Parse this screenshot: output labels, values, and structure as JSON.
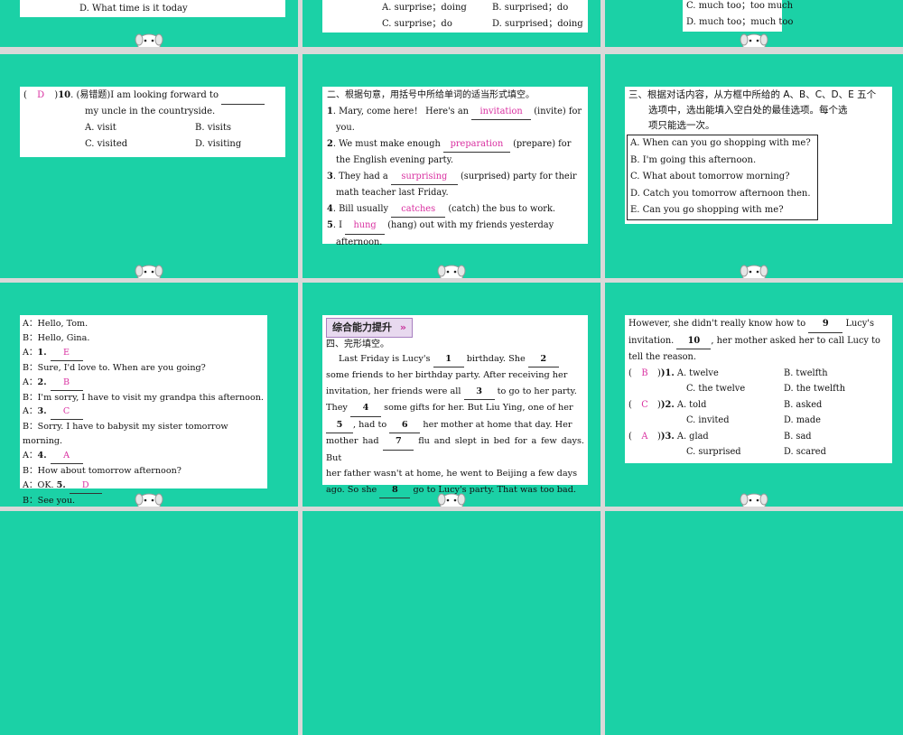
{
  "s1": {
    "d": "D. What time is it today"
  },
  "s2": {
    "a": "A. surprise；doing",
    "b": "B. surprised；do",
    "c": "C. surprise；do",
    "d": "D. surprised；doing"
  },
  "s3": {
    "c": "C. much too；too much",
    "d": "D. much too；much too"
  },
  "s4": {
    "ans": "D",
    "num": "10",
    "q1": ". (易错题)I am looking forward to",
    "q2": "my uncle in the countryside.",
    "opts": [
      "A. visit",
      "B. visits",
      "C. visited",
      "D. visiting"
    ]
  },
  "s5": {
    "title": "二、根据句意，用括号中所给单词的适当形式填空。",
    "items": [
      {
        "n": "1",
        "pre": "Mary, come here！ Here's an",
        "ans": "invitation",
        "post": "(invite) for",
        "cont": "you."
      },
      {
        "n": "2",
        "pre": "We must make enough",
        "ans": "preparation",
        "post": "(prepare) for",
        "cont": "the English evening party."
      },
      {
        "n": "3",
        "pre": "They had a",
        "ans": "surprising",
        "post": "(surprised) party for their",
        "cont": "math teacher last Friday."
      },
      {
        "n": "4",
        "pre": "Bill usually",
        "ans": "catches",
        "post": "(catch) the bus to work.",
        "cont": ""
      },
      {
        "n": "5",
        "pre": "I",
        "ans": "hung",
        "post": "(hang) out with my friends yesterday",
        "cont": "afternoon."
      }
    ]
  },
  "s6": {
    "title1": "三、根据对话内容，从方框中所给的 A、B、C、D、E 五个",
    "title2": "选项中，选出能填入空白处的最佳选项。每个选",
    "title3": "项只能选一次。",
    "opts": [
      "A. When can you go shopping with me?",
      "B. I'm going this afternoon.",
      "C. What about tomorrow morning?",
      "D. Catch you tomorrow afternoon then.",
      "E. Can you go shopping with me?"
    ]
  },
  "s7": {
    "lines": [
      {
        "pre": "A：Hello, Tom.",
        "n": "",
        "ans": ""
      },
      {
        "pre": "B：Hello, Gina.",
        "n": "",
        "ans": ""
      },
      {
        "pre": "A：",
        "n": "1.",
        "ans": "E"
      },
      {
        "pre": "B：Sure, I'd love to. When are you going?",
        "n": "",
        "ans": ""
      },
      {
        "pre": "A：",
        "n": "2.",
        "ans": "B"
      },
      {
        "pre": "B：I'm sorry, I have to visit my grandpa this afternoon.",
        "n": "",
        "ans": ""
      },
      {
        "pre": "A：",
        "n": "3.",
        "ans": "C"
      },
      {
        "pre": "B：Sorry. I have to babysit my sister tomorrow morning.",
        "n": "",
        "ans": ""
      },
      {
        "pre": "A：",
        "n": "4.",
        "ans": "A"
      },
      {
        "pre": "B：How about tomorrow afternoon?",
        "n": "",
        "ans": ""
      },
      {
        "pre": "A：OK. ",
        "n": "5.",
        "ans": "D"
      },
      {
        "pre": "B：See you.",
        "n": "",
        "ans": ""
      }
    ]
  },
  "s8": {
    "badge": "综合能力提升",
    "section": "四、完形填空。",
    "p": [
      "Last Friday is Lucy's",
      "birthday. She",
      "some friends to her birthday party. After receiving her",
      "invitation, her friends were all",
      "to go to her party.",
      "They",
      "some gifts for her. But Liu Ying, one of her",
      ", had to",
      "her mother at home that day. Her",
      "mother had",
      "flu and slept in bed for a few days. But",
      "her father wasn't at home, he went to Beijing a few days",
      "ago. So she",
      "go to Lucy's party. That was too bad."
    ],
    "blanks": [
      "1",
      "2",
      "3",
      "4",
      "5",
      "6",
      "7",
      "8"
    ]
  },
  "s9": {
    "l1a": "However, she didn't really know how to",
    "b9": "9",
    "l1b": "Lucy's",
    "l2a": "invitation.",
    "b10": "10",
    "l2b": ", her mother asked her to call Lucy to",
    "l3": "tell the reason.",
    "q": [
      {
        "ans": "B",
        "n": ")1.",
        "a": "A. twelve",
        "b": "B. twelfth",
        "c": "C. the twelve",
        "d": "D. the twelfth"
      },
      {
        "ans": "C",
        "n": ")2.",
        "a": "A. told",
        "b": "B. asked",
        "c": "C. invited",
        "d": "D. made"
      },
      {
        "ans": "A",
        "n": ")3.",
        "a": "A. glad",
        "b": "B. sad",
        "c": "C. surprised",
        "d": "D. scared"
      }
    ]
  }
}
